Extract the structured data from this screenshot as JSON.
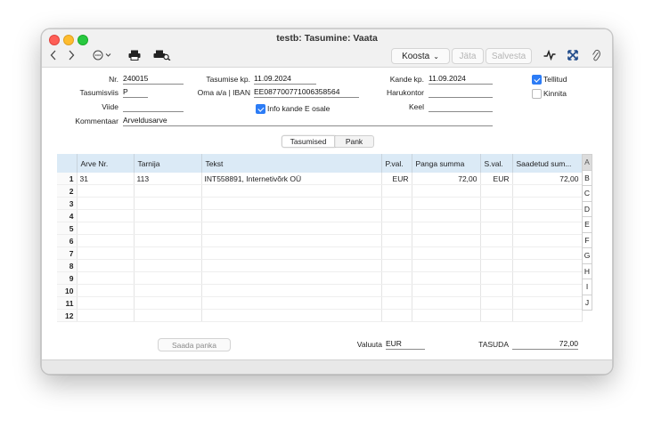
{
  "window": {
    "title": "testb: Tasumine: Vaata"
  },
  "toolbar": {
    "koosta_label": "Koosta",
    "jata_label": "Jäta",
    "salvesta_label": "Salvesta"
  },
  "header": {
    "nr_label": "Nr.",
    "nr_value": "240015",
    "tasumise_kp_label": "Tasumise kp.",
    "tasumise_kp_value": "11.09.2024",
    "kande_kp_label": "Kande kp.",
    "kande_kp_value": "11.09.2024",
    "tasumisviis_label": "Tasumisviis",
    "tasumisviis_value": "P",
    "oma_aa_label": "Oma a/a | IBAN",
    "oma_aa_value": "EE087700771006358564",
    "harukontor_label": "Harukontor",
    "harukontor_value": "",
    "viide_label": "Viide",
    "viide_value": "",
    "info_kande_label": "Info kande E osale",
    "keel_label": "Keel",
    "keel_value": "",
    "kommentaar_label": "Kommentaar",
    "kommentaar_value": "Arveldusarve",
    "tellitud_label": "Tellitud",
    "kinnita_label": "Kinnita"
  },
  "checkboxes": {
    "tellitud": true,
    "kinnita": false,
    "info_kande": true
  },
  "tabs": [
    "Tasumised",
    "Pank"
  ],
  "table": {
    "columns": [
      "Arve Nr.",
      "Tarnija",
      "Tekst",
      "P.val.",
      "Panga summa",
      "S.val.",
      "Saadetud sum..."
    ],
    "rows": [
      {
        "num": "1",
        "arve": "31",
        "tarnija": "113",
        "tekst": "INT558891, Internetivõrk OÜ",
        "pval": "EUR",
        "panga": "72,00",
        "sval": "EUR",
        "saadetud": "72,00"
      },
      {
        "num": "2",
        "arve": "",
        "tarnija": "",
        "tekst": "",
        "pval": "",
        "panga": "",
        "sval": "",
        "saadetud": ""
      },
      {
        "num": "3",
        "arve": "",
        "tarnija": "",
        "tekst": "",
        "pval": "",
        "panga": "",
        "sval": "",
        "saadetud": ""
      },
      {
        "num": "4",
        "arve": "",
        "tarnija": "",
        "tekst": "",
        "pval": "",
        "panga": "",
        "sval": "",
        "saadetud": ""
      },
      {
        "num": "5",
        "arve": "",
        "tarnija": "",
        "tekst": "",
        "pval": "",
        "panga": "",
        "sval": "",
        "saadetud": ""
      },
      {
        "num": "6",
        "arve": "",
        "tarnija": "",
        "tekst": "",
        "pval": "",
        "panga": "",
        "sval": "",
        "saadetud": ""
      },
      {
        "num": "7",
        "arve": "",
        "tarnija": "",
        "tekst": "",
        "pval": "",
        "panga": "",
        "sval": "",
        "saadetud": ""
      },
      {
        "num": "8",
        "arve": "",
        "tarnija": "",
        "tekst": "",
        "pval": "",
        "panga": "",
        "sval": "",
        "saadetud": ""
      },
      {
        "num": "9",
        "arve": "",
        "tarnija": "",
        "tekst": "",
        "pval": "",
        "panga": "",
        "sval": "",
        "saadetud": ""
      },
      {
        "num": "10",
        "arve": "",
        "tarnija": "",
        "tekst": "",
        "pval": "",
        "panga": "",
        "sval": "",
        "saadetud": ""
      },
      {
        "num": "11",
        "arve": "",
        "tarnija": "",
        "tekst": "",
        "pval": "",
        "panga": "",
        "sval": "",
        "saadetud": ""
      },
      {
        "num": "12",
        "arve": "",
        "tarnija": "",
        "tekst": "",
        "pval": "",
        "panga": "",
        "sval": "",
        "saadetud": ""
      }
    ]
  },
  "letters": [
    "A",
    "B",
    "C",
    "D",
    "E",
    "F",
    "G",
    "H",
    "I",
    "J"
  ],
  "footer": {
    "saada_panka_label": "Saada panka",
    "valuuta_label": "Valuuta",
    "valuuta_value": "EUR",
    "tasuda_label": "TASUDA",
    "tasuda_value": "72,00"
  },
  "icons": {
    "back": "chevron-left-icon",
    "forward": "chevron-right-icon",
    "more": "ellipsis-circle-icon",
    "print": "printer-icon",
    "print_preview": "print-preview-icon",
    "activity": "activity-icon",
    "expand": "expand-icon",
    "attach": "paperclip-icon"
  },
  "colors": {
    "accent": "#2c7cf6",
    "header_row": "#dbeaf6"
  }
}
